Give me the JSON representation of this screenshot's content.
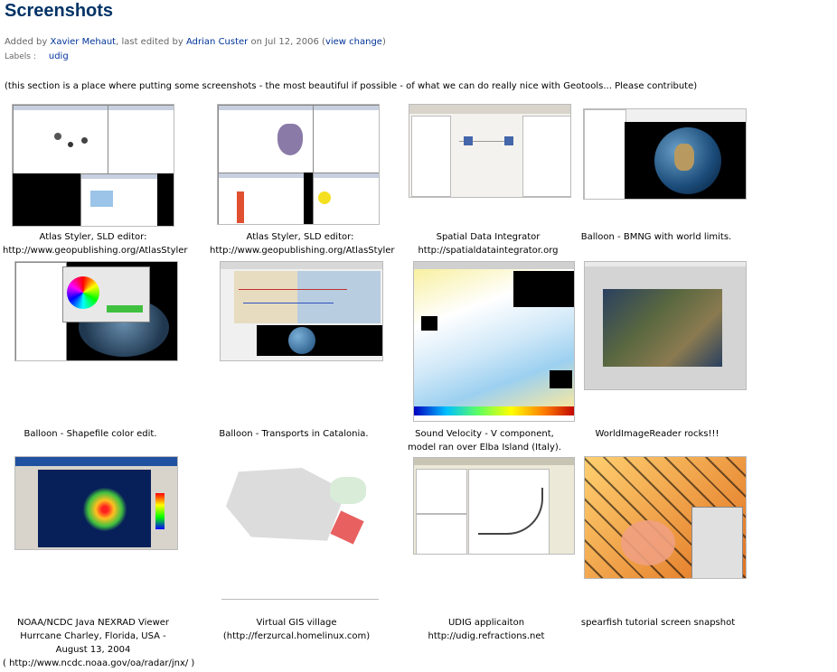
{
  "page": {
    "title": "Screenshots",
    "meta": {
      "prefix": "Added by ",
      "author": "Xavier Mehaut",
      "middle": ", last edited by ",
      "editor": "Adrian Custer",
      "date_text": " on Jul 12, 2006  (",
      "view_change": "view change",
      "suffix": ")"
    },
    "labels": {
      "label": "Labels :",
      "tag": "udig"
    },
    "intro": "(this section is a place where putting some screenshots - the most beautiful if possible - of what we can do really nice with Geotools... Please contribute)"
  },
  "gallery": [
    {
      "caption": [
        "Atlas Styler, SLD editor:",
        "http://www.geopublishing.org/AtlasStyler"
      ]
    },
    {
      "caption": [
        "Atlas Styler, SLD editor:",
        "http://www.geopublishing.org/AtlasStyler"
      ]
    },
    {
      "caption": [
        "Spatial Data Integrator",
        "http://spatialdataintegrator.org"
      ]
    },
    {
      "caption": [
        "Balloon - BMNG with world limits."
      ]
    },
    {
      "caption": [
        "Balloon - Shapefile color edit."
      ]
    },
    {
      "caption": [
        "Balloon - Transports in Catalonia."
      ]
    },
    {
      "caption": [
        "Sound Velocity - V component,",
        "model ran over Elba Island (Italy)."
      ]
    },
    {
      "caption": [
        "WorldImageReader rocks!!!"
      ]
    },
    {
      "caption": [
        "NOAA/NCDC Java NEXRAD Viewer",
        "Hurrcane Charley, Florida, USA -",
        "August 13, 2004",
        "( http://www.ncdc.noaa.gov/oa/radar/jnx/ )"
      ]
    },
    {
      "caption": [
        "Virtual GIS village",
        "(http://ferzurcal.homelinux.com)"
      ]
    },
    {
      "caption": [
        "UDIG applicaiton",
        "http://udig.refractions.net"
      ]
    },
    {
      "caption": [
        "spearfish tutorial screen snapshot"
      ]
    }
  ],
  "colors": {
    "title": "#003366",
    "link": "#003399",
    "meta": "#666666"
  }
}
